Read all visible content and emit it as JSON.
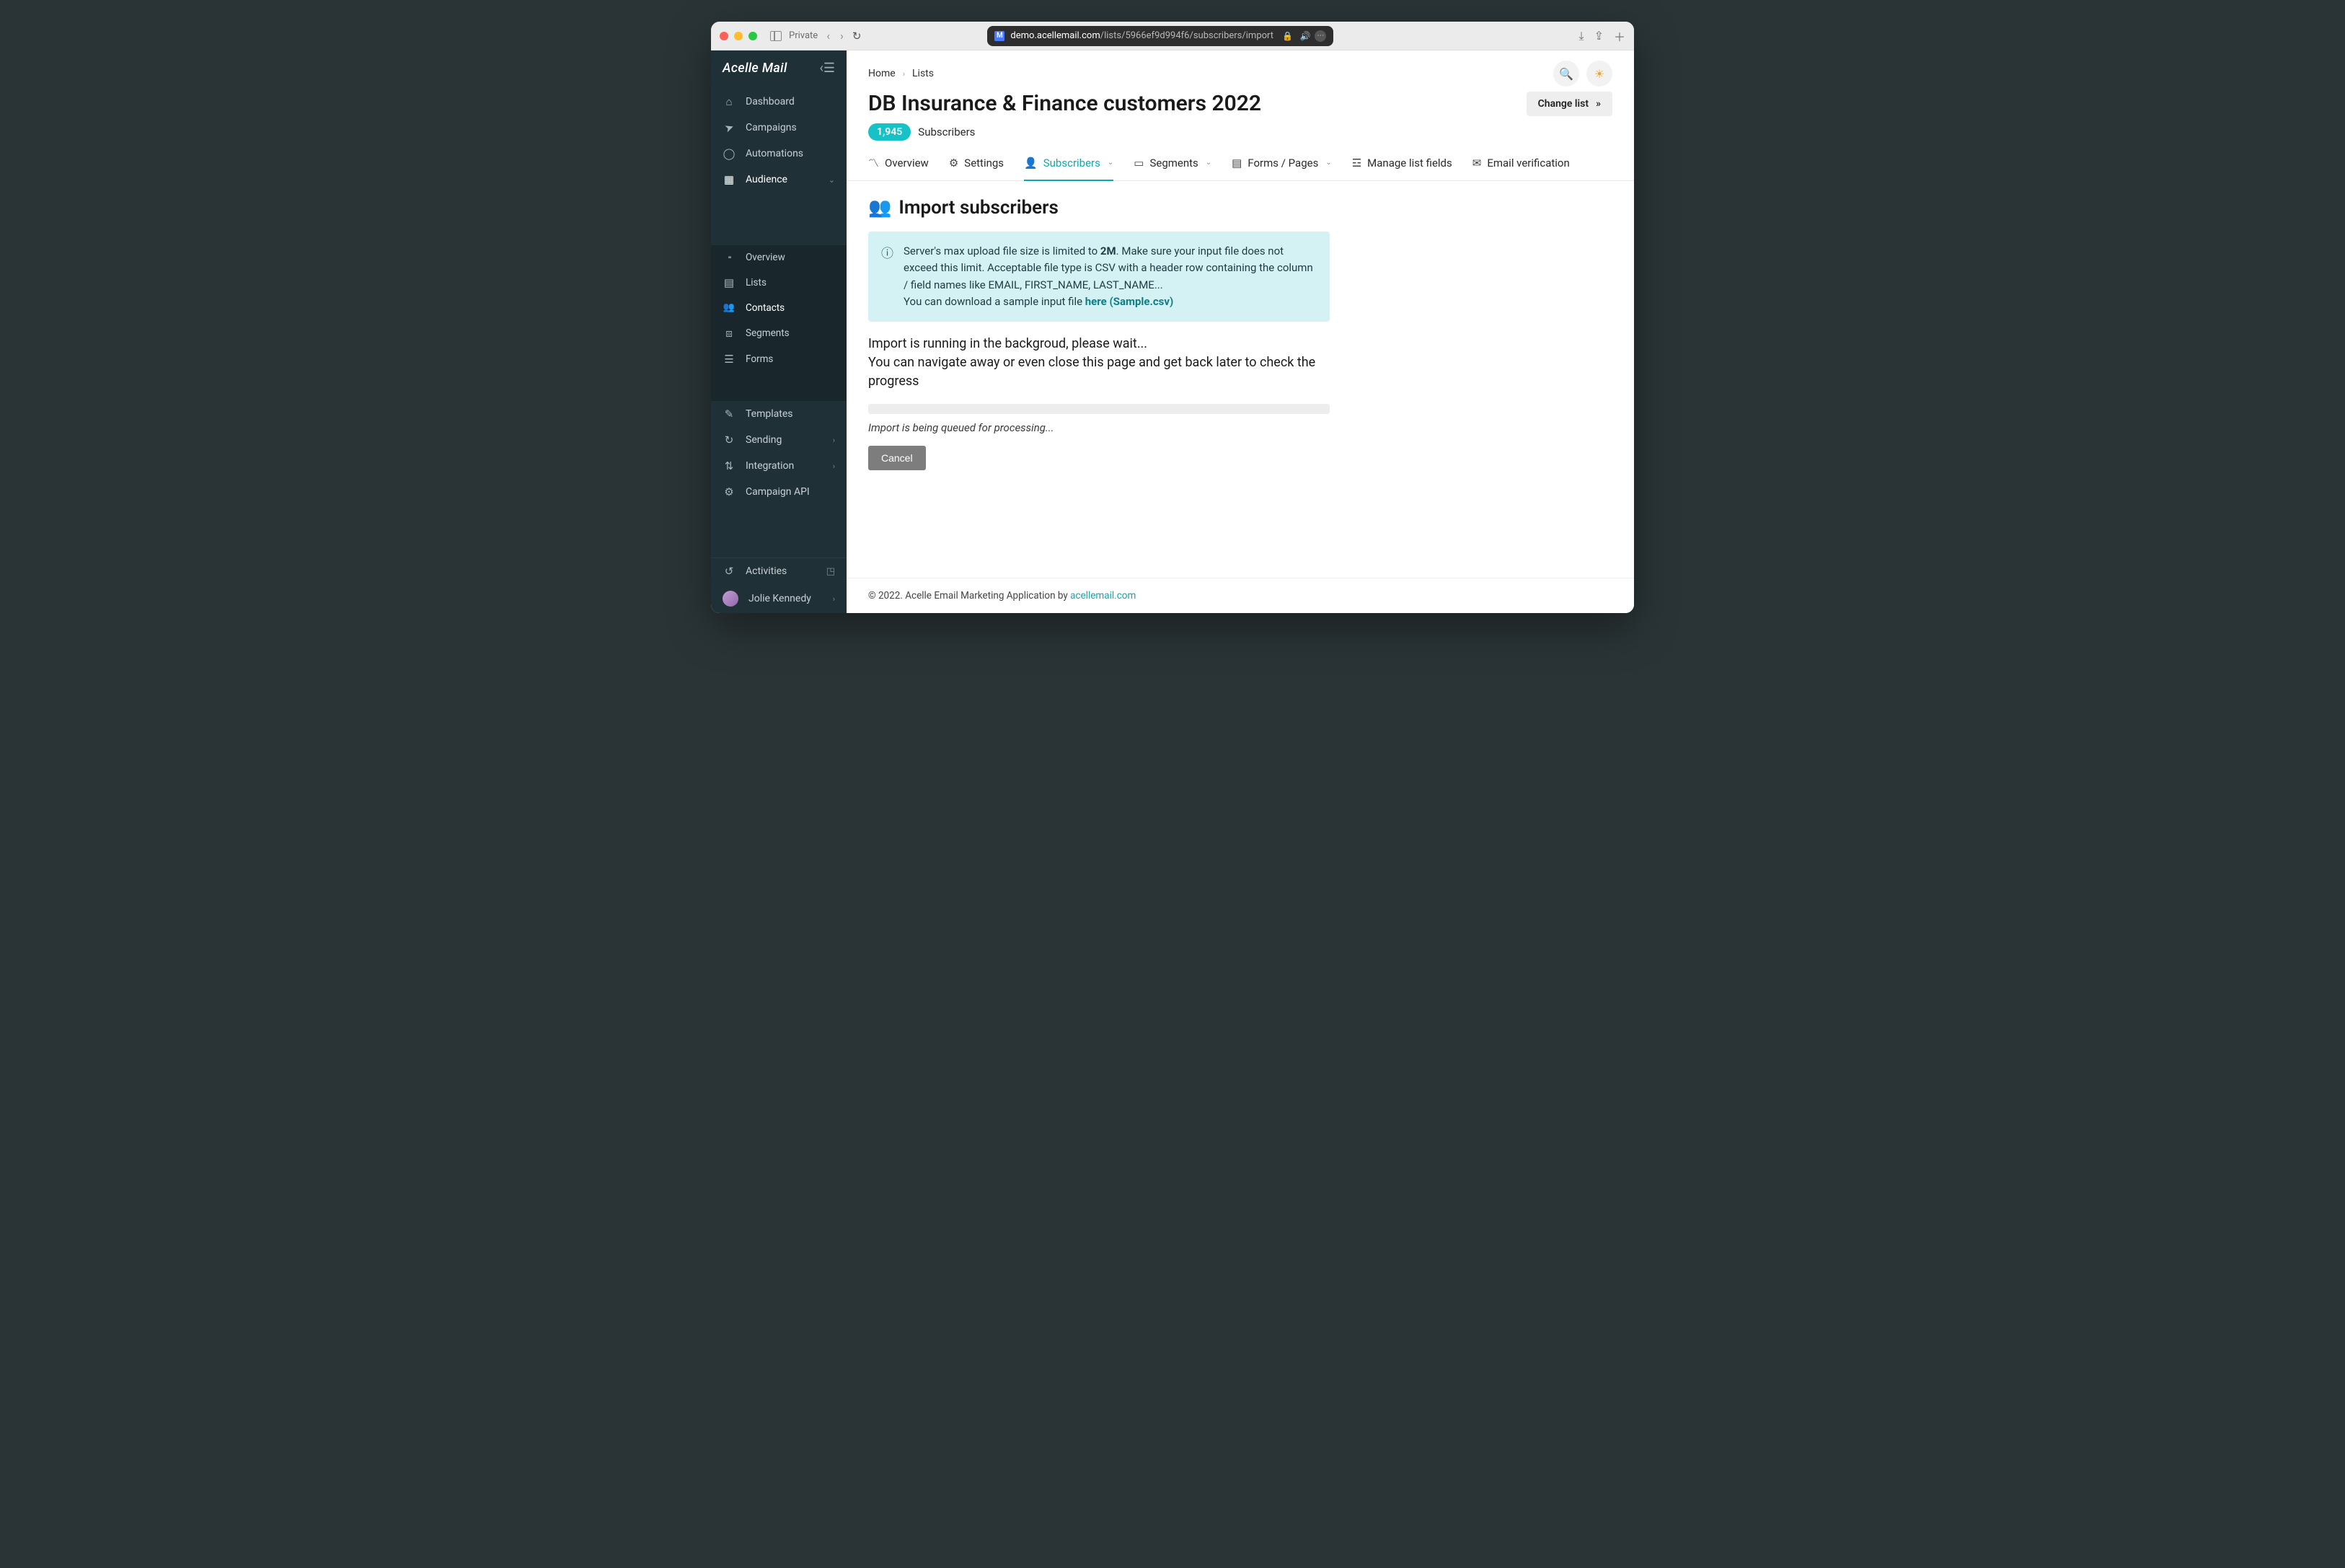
{
  "browser": {
    "private_label": "Private",
    "url_host": "demo.acellemail.com",
    "url_path": "/lists/5966ef9d994f6/subscribers/import"
  },
  "brand": "Acelle Mail",
  "sidebar": {
    "items": [
      {
        "label": "Dashboard"
      },
      {
        "label": "Campaigns"
      },
      {
        "label": "Automations"
      },
      {
        "label": "Audience",
        "expandable": true,
        "active": true
      },
      {
        "label": "Templates"
      },
      {
        "label": "Sending",
        "expandable": true
      },
      {
        "label": "Integration",
        "expandable": true
      },
      {
        "label": "Campaign API"
      }
    ],
    "audience_sub": [
      {
        "label": "Overview"
      },
      {
        "label": "Lists"
      },
      {
        "label": "Contacts",
        "current": true
      },
      {
        "label": "Segments"
      },
      {
        "label": "Forms"
      }
    ],
    "footer": {
      "activities": "Activities",
      "user": "Jolie Kennedy"
    }
  },
  "breadcrumbs": [
    "Home",
    "Lists"
  ],
  "page": {
    "title": "DB Insurance & Finance customers 2022",
    "change_list": "Change list",
    "subscriber_count": "1,945",
    "subscriber_label": "Subscribers"
  },
  "tabs": [
    {
      "label": "Overview"
    },
    {
      "label": "Settings"
    },
    {
      "label": "Subscribers",
      "dropdown": true,
      "active": true
    },
    {
      "label": "Segments",
      "dropdown": true
    },
    {
      "label": "Forms / Pages",
      "dropdown": true
    },
    {
      "label": "Manage list fields"
    },
    {
      "label": "Email verification"
    }
  ],
  "section": {
    "heading": "Import subscribers",
    "info_line1_a": "Server's max upload file size is limited to ",
    "info_line1_bold": "2M",
    "info_line1_b": ". Make sure your input file does not exceed this limit. Acceptable file type is CSV with a header row containing the column / field names like EMAIL, FIRST_NAME, LAST_NAME...",
    "info_line2_a": "You can download a sample input file ",
    "info_link": "here (Sample.csv)",
    "status_1": "Import is running in the backgroud, please wait...",
    "status_2": "You can navigate away or even close this page and get back later to check the progress",
    "queue_msg": "Import is being queued for processing...",
    "cancel": "Cancel"
  },
  "footer": {
    "text": "© 2022. Acelle Email Marketing Application by ",
    "link": "acellemail.com"
  }
}
